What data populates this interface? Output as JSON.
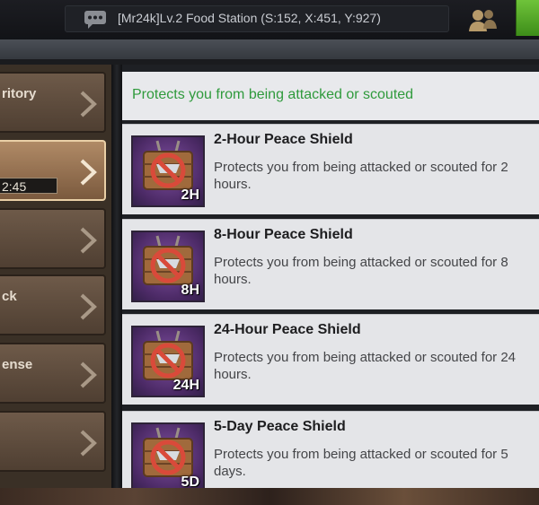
{
  "chat": {
    "message": "[Mr24k]Lv.2 Food Station (S:152, X:451, Y:927)"
  },
  "sidebar": {
    "items": [
      {
        "label": "ritory",
        "active": false
      },
      {
        "label": "",
        "active": true,
        "timer": "2:45"
      },
      {
        "label": "",
        "active": false
      },
      {
        "label": "ck",
        "active": false
      },
      {
        "label": "ense",
        "active": false
      },
      {
        "label": "",
        "active": false
      }
    ]
  },
  "main": {
    "info_text": "Protects you from being attacked or scouted",
    "items": [
      {
        "title": "2-Hour Peace Shield",
        "desc": "Protects you from being attacked or scouted for 2 hours.",
        "duration": "2H"
      },
      {
        "title": "8-Hour Peace Shield",
        "desc": "Protects you from being attacked or scouted for 8 hours.",
        "duration": "8H"
      },
      {
        "title": "24-Hour Peace Shield",
        "desc": "Protects you from being attacked or scouted for 24 hours.",
        "duration": "24H"
      },
      {
        "title": "5-Day Peace Shield",
        "desc": "Protects you from being attacked or scouted for 5 days.",
        "duration": "5D"
      }
    ]
  },
  "colors": {
    "info_text": "#2f9a3c",
    "active_tab_border": "#e9cfa6",
    "confirm_button": "#4fa526"
  }
}
